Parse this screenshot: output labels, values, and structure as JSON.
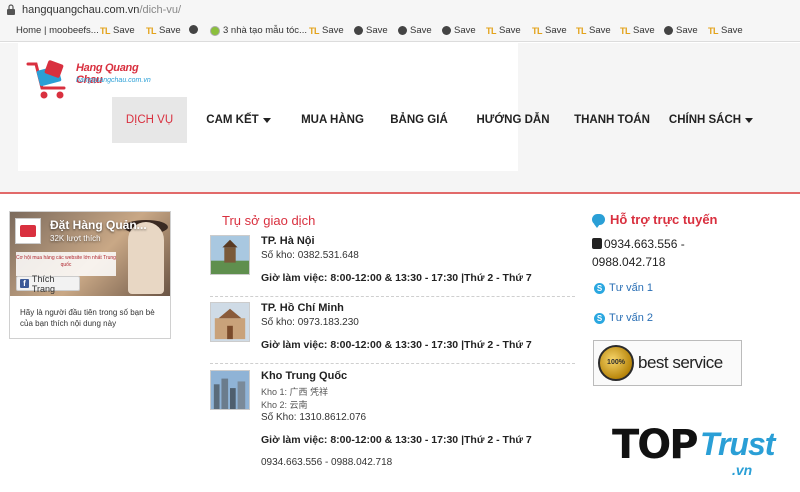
{
  "browser": {
    "url_host": "hangquangchau.com.vn",
    "url_path": "/dich-vu/",
    "bookmarks": [
      {
        "label": "Home | moobeefs...",
        "icon": "page-icon"
      },
      {
        "label": "Save",
        "icon": "tl-icon"
      },
      {
        "label": "Save",
        "icon": "tl-icon"
      },
      {
        "label": "",
        "icon": "globe-icon"
      },
      {
        "label": "3 nhà tạo mẫu tóc...",
        "icon": "check-icon"
      },
      {
        "label": "Save",
        "icon": "tl-icon"
      },
      {
        "label": "Save",
        "icon": "globe-icon"
      },
      {
        "label": "Save",
        "icon": "globe-icon"
      },
      {
        "label": "Save",
        "icon": "globe-icon"
      },
      {
        "label": "Save",
        "icon": "tl-icon"
      },
      {
        "label": "Save",
        "icon": "tl-icon"
      },
      {
        "label": "Save",
        "icon": "tl-icon"
      },
      {
        "label": "Save",
        "icon": "tl-icon"
      },
      {
        "label": "Save",
        "icon": "globe-icon"
      },
      {
        "label": "Save",
        "icon": "tl-icon"
      }
    ]
  },
  "logo": {
    "title": "Hang Quang Chau",
    "subtitle": "hangquangchau.com.vn"
  },
  "nav": {
    "items": [
      {
        "label": "DỊCH VỤ",
        "active": true,
        "dropdown": false
      },
      {
        "label": "CAM KẾT",
        "active": false,
        "dropdown": true
      },
      {
        "label": "MUA HÀNG",
        "active": false,
        "dropdown": false
      },
      {
        "label": "BẢNG GIÁ",
        "active": false,
        "dropdown": false
      },
      {
        "label": "HƯỚNG DẪN",
        "active": false,
        "dropdown": false
      },
      {
        "label": "THANH TOÁN",
        "active": false,
        "dropdown": false
      },
      {
        "label": "CHÍNH SÁCH",
        "active": false,
        "dropdown": true
      }
    ]
  },
  "facebook": {
    "page_name": "Đặt Hàng Quản...",
    "likes": "32K lượt thích",
    "cover_text": "Cơ hội mua hàng các website lớn nhất Trung quốc",
    "like_button": "Thích Trang",
    "prompt": "Hãy là người đầu tiên trong số bạn bè của bạn thích nội dung này"
  },
  "offices": {
    "title": "Trụ sở giao dịch",
    "hours_label": "Giờ làm việc: 8:00-12:00 & 13:30 - 17:30 |Thứ 2 - Thứ 7",
    "list": [
      {
        "name": "TP. Hà Nội",
        "lines": [
          "Số kho: 0382.531.648"
        ]
      },
      {
        "name": "TP. Hồ Chí Minh",
        "lines": [
          "Số kho: 0973.183.230"
        ]
      },
      {
        "name": "Kho Trung Quốc",
        "lines": [
          "Kho 1: 广西 凭祥",
          "Kho 2: 云南",
          "Số Kho: 1310.8612.076"
        ]
      }
    ],
    "footer_phones": "0934.663.556 - 0988.042.718"
  },
  "support": {
    "title": "Hỗ trợ trực tuyến",
    "phone_line1": "0934.663.556 -",
    "phone_line2": "0988.042.718",
    "advisors": [
      "Tư vấn 1",
      "Tư vấn 2"
    ]
  },
  "badges": {
    "best_service": "best service",
    "medal_text": "100%",
    "toptrust_top": "TOP",
    "toptrust_trust": "Trust",
    "toptrust_vn": ".vn"
  },
  "colors": {
    "accent": "#d9303f",
    "link": "#2a6fb5",
    "skype": "#2aa7e0"
  }
}
